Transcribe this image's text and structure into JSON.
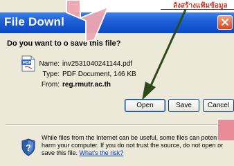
{
  "dialog": {
    "title": "File Downl",
    "question": "Do you want to o    save this file?",
    "name_label": "Name:",
    "name_value": "inv2531040241144.pdf",
    "type_label": "Type:",
    "type_value": "PDF Document, 146 KB",
    "from_label": "From:",
    "from_value": "reg.rmutr.ac.th",
    "buttons": {
      "open": "Open",
      "save": "Save",
      "cancel": "Cancel"
    },
    "warning_text": "While files from the Internet can be useful, some files can potentially harm your computer. If you do not trust the source, do not open or save this file.",
    "warning_link": "What's the risk?"
  },
  "annotation": {
    "banner_text": "ลังสร้างแฟ้มข้อมูล",
    "colors": {
      "arrow_fill": "#F0A6B0",
      "arrow_stroke": "#FFFFFF",
      "pointer_line": "#2E4A1A",
      "titlebar": "#0A49C6",
      "close": "#D7451F"
    }
  }
}
